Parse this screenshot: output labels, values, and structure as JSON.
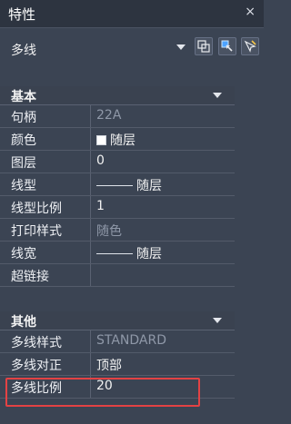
{
  "window": {
    "title": "特性",
    "close_label": "×"
  },
  "selector": {
    "value": "多线"
  },
  "sections": {
    "basic": {
      "title": "基本",
      "rows": [
        {
          "label": "句柄",
          "value": "22A",
          "dim": true
        },
        {
          "label": "颜色",
          "value": "随层",
          "swatch": true
        },
        {
          "label": "图层",
          "value": "0"
        },
        {
          "label": "线型",
          "value": "随层",
          "line": true
        },
        {
          "label": "线型比例",
          "value": "1"
        },
        {
          "label": "打印样式",
          "value": "随色",
          "dim": true
        },
        {
          "label": "线宽",
          "value": "随层",
          "line": true
        },
        {
          "label": "超链接",
          "value": ""
        }
      ]
    },
    "other": {
      "title": "其他",
      "rows": [
        {
          "label": "多线样式",
          "value": "STANDARD",
          "dim": true
        },
        {
          "label": "多线对正",
          "value": "顶部"
        },
        {
          "label": "多线比例",
          "value": "20"
        }
      ]
    }
  },
  "colors": {
    "highlight": "#e34244",
    "background": "#3b4453",
    "titlebar": "#2d3440"
  },
  "icons": [
    "quick-select-icon",
    "select-objects-icon",
    "toggle-pickadd-icon"
  ]
}
